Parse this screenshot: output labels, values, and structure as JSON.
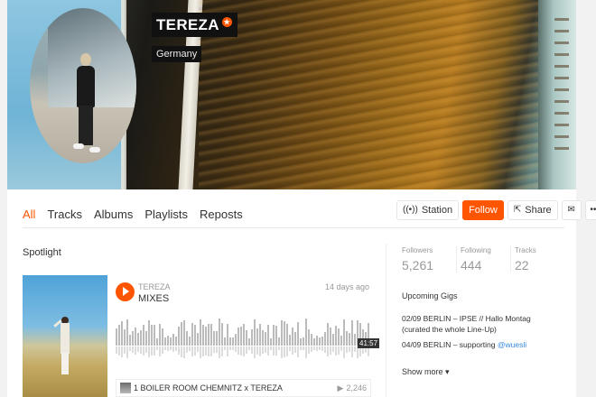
{
  "profile": {
    "name": "TEREZA",
    "pro_badge": "★",
    "country": "Germany"
  },
  "tabs": [
    {
      "label": "All",
      "active": true
    },
    {
      "label": "Tracks",
      "active": false
    },
    {
      "label": "Albums",
      "active": false
    },
    {
      "label": "Playlists",
      "active": false
    },
    {
      "label": "Reposts",
      "active": false
    }
  ],
  "actions": {
    "station_label": "Station",
    "station_icon": "((•))",
    "follow_label": "Follow",
    "share_label": "Share",
    "share_icon": "⇱",
    "message_icon": "✉",
    "more_icon": "•••"
  },
  "spotlight": {
    "title": "Spotlight",
    "track": {
      "artist": "TEREZA",
      "title": "MIXES",
      "posted_ago": "14 days ago",
      "duration": "41:57",
      "first_item": "1 BOILER ROOM CHEMNITZ x TEREZA",
      "plays_icon": "▶",
      "first_item_plays": "2,246"
    }
  },
  "stats": [
    {
      "label": "Followers",
      "value": "5,261"
    },
    {
      "label": "Following",
      "value": "444"
    },
    {
      "label": "Tracks",
      "value": "22"
    }
  ],
  "gigs": {
    "title": "Upcoming Gigs",
    "gig1": "02/09 BERLIN – IPSE // Hallo Montag (curated the whole Line-Up)",
    "gig2_prefix": "04/09 BERLIN – supporting ",
    "gig2_link": "@wuesli",
    "show_more": "Show more ▾"
  },
  "colors": {
    "accent": "#ff5500",
    "link": "#3388dd"
  }
}
